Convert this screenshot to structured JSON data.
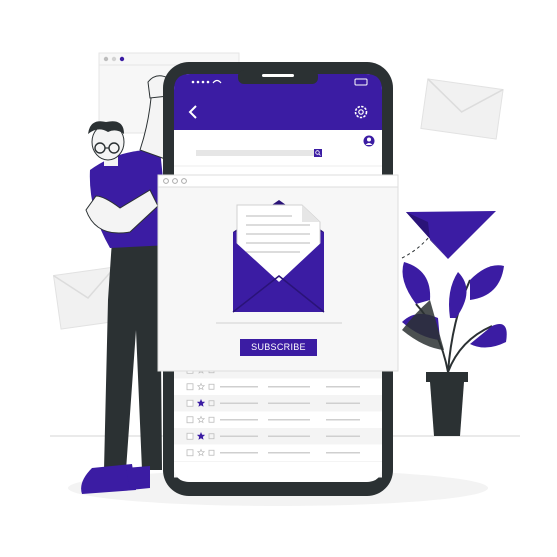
{
  "colors": {
    "brand": "#3b1ca3",
    "dark": "#2b3133",
    "light_gray": "#ebebeb",
    "mid_gray": "#d6d6d6",
    "skin": "#f1f1f1",
    "white": "#ffffff"
  },
  "icons": {
    "back": "chevron-left-icon",
    "settings": "gear-icon",
    "search": "search-icon",
    "profile": "user-icon",
    "mail": "envelope-icon",
    "send": "paper-plane-icon",
    "star": "star-icon"
  },
  "newsletter": {
    "subscribe_label": "SUBSCRIBE"
  },
  "inbox": {
    "rows": [
      {
        "starred": false
      },
      {
        "starred": false
      },
      {
        "starred": true
      },
      {
        "starred": false
      },
      {
        "starred": true
      },
      {
        "starred": false
      },
      {
        "starred": true
      }
    ]
  }
}
